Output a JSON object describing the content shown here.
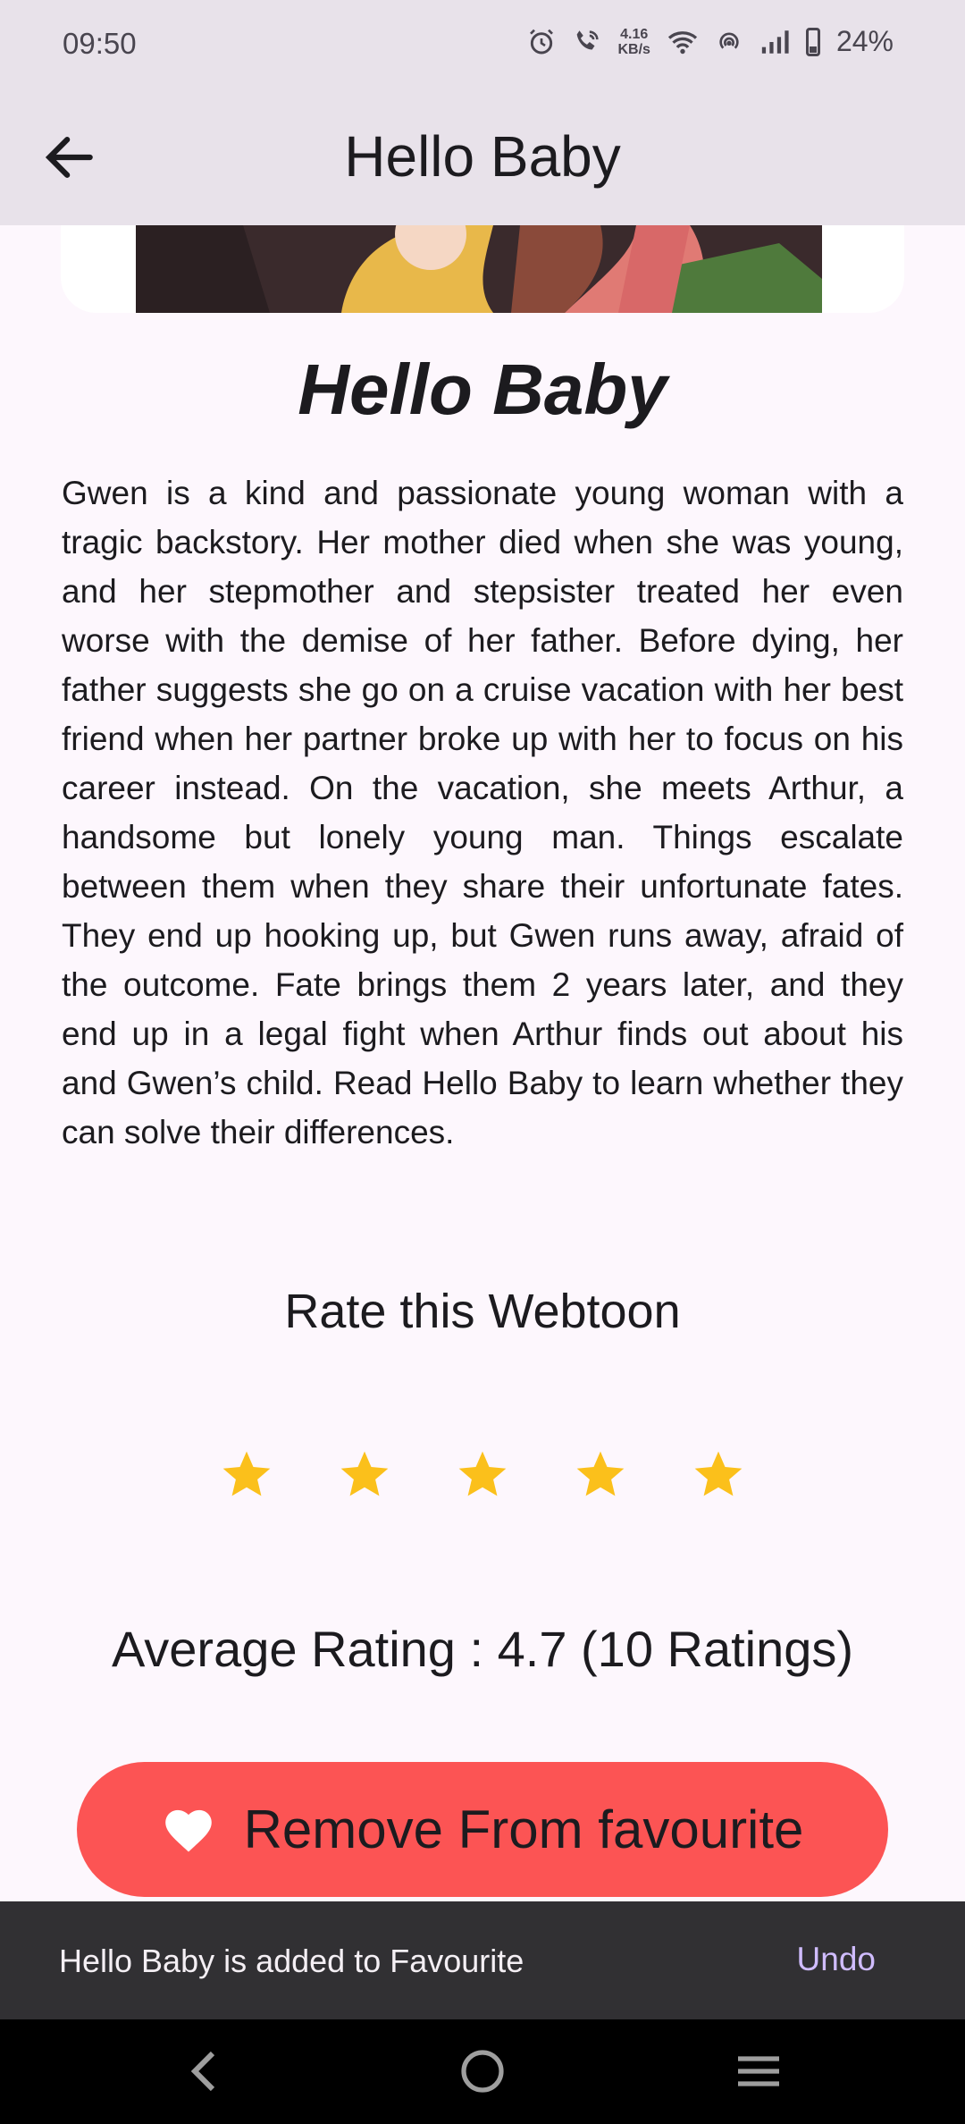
{
  "status": {
    "time": "09:50",
    "net_speed_value": "4.16",
    "net_speed_unit": "KB/s",
    "battery": "24%",
    "battery_level": 0.24
  },
  "app_bar": {
    "title": "Hello Baby"
  },
  "detail": {
    "title": "Hello Baby",
    "description": "Gwen is a kind and passionate young woman with a tragic backstory. Her mother died when she was young, and her stepmother and stepsister treated her even worse with the demise of her father. Before dying, her father suggests she go on a cruise vacation with her best friend when her partner broke up with her to focus on his career instead. On the vacation, she meets Arthur, a handsome but lonely young man. Things escalate between them when they share their unfortunate fates. They end up hooking up, but Gwen runs away, afraid of the outcome. Fate brings them 2 years later, and they end up in a legal fight when Arthur finds out about his and Gwen’s child. Read Hello Baby to learn whether they can solve their differences."
  },
  "rating": {
    "heading": "Rate this Webtoon",
    "stars_total": 5,
    "stars_filled": 5,
    "star_color": "#fbc01b",
    "average_text": "Average Rating : 4.7 (10 Ratings)"
  },
  "favourite_button": {
    "label": "Remove From favourite",
    "color": "#fc5454"
  },
  "snackbar": {
    "message": "Hello Baby is added to Favourite",
    "action": "Undo"
  },
  "icons": {
    "back": "arrow-left-icon",
    "heart": "heart-icon",
    "nav_back": "chevron-left-icon",
    "nav_home": "circle-home-icon",
    "nav_menu": "menu-lines-icon"
  }
}
